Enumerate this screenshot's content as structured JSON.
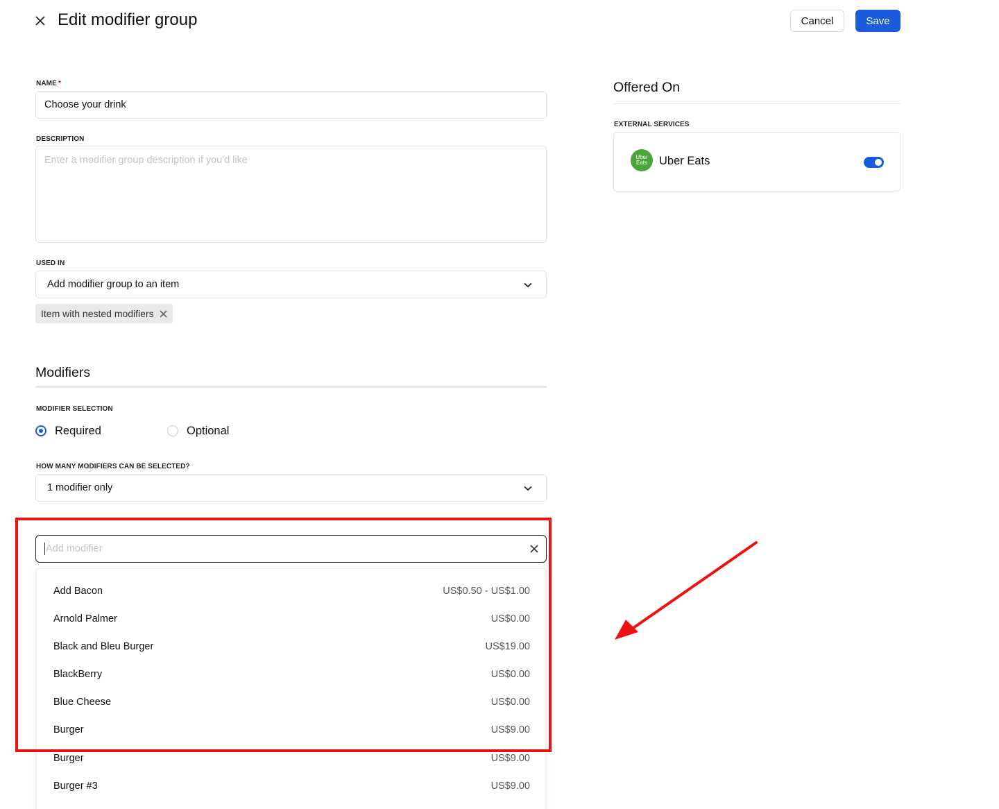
{
  "header": {
    "title": "Edit modifier group",
    "cancel_label": "Cancel",
    "save_label": "Save"
  },
  "form": {
    "name": {
      "label": "NAME",
      "required_mark": "*",
      "value": "Choose your drink"
    },
    "description": {
      "label": "DESCRIPTION",
      "placeholder": "Enter a modifier group description if you'd like"
    },
    "used_in": {
      "label": "USED IN",
      "select_value": "Add modifier group to an item",
      "chips": [
        "Item with nested modifiers"
      ]
    }
  },
  "modifiers": {
    "title": "Modifiers",
    "selection_label": "MODIFIER SELECTION",
    "options": [
      {
        "label": "Required",
        "selected": true
      },
      {
        "label": "Optional",
        "selected": false
      }
    ],
    "count_label": "HOW MANY MODIFIERS CAN BE SELECTED?",
    "count_value": "1 modifier only",
    "search_placeholder": "Add modifier",
    "list": [
      {
        "name": "Add Bacon",
        "price": "US$0.50 - US$1.00"
      },
      {
        "name": "Arnold Palmer",
        "price": "US$0.00"
      },
      {
        "name": "Black and Bleu Burger",
        "price": "US$19.00"
      },
      {
        "name": "BlackBerry",
        "price": "US$0.00"
      },
      {
        "name": "Blue Cheese",
        "price": "US$0.00"
      },
      {
        "name": "Burger",
        "price": "US$9.00"
      },
      {
        "name": "Burger",
        "price": "US$9.00"
      },
      {
        "name": "Burger #3",
        "price": "US$9.00"
      }
    ]
  },
  "offered_on": {
    "title": "Offered On",
    "external_label": "EXTERNAL SERVICES",
    "service": {
      "name": "Uber Eats",
      "logo_line1": "Uber",
      "logo_line2": "Eats",
      "enabled": true
    }
  },
  "colors": {
    "accent": "#1a5bdb",
    "annotation": "#ee1111",
    "uber_green": "#4aa63a"
  }
}
